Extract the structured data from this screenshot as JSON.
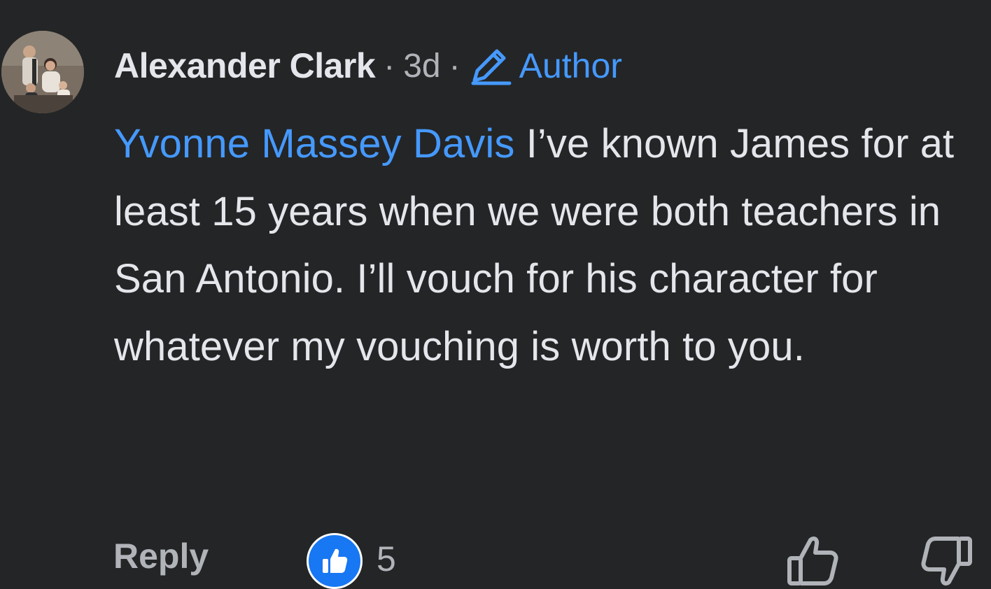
{
  "comment": {
    "author": "Alexander Clark",
    "separator": "·",
    "time": "3d",
    "badge": "Author",
    "mention": "Yvonne Massey Davis",
    "text": " I’ve known James for at least 15 years when we were both teachers in San Antonio. I’ll vouch for his character for whatever my vouching is worth to you."
  },
  "actions": {
    "reply_label": "Reply",
    "like_count": "5"
  },
  "icons": {
    "badge_icon": "pencil-icon",
    "reaction_icon": "thumbs-up-reaction-icon",
    "upvote_icon": "thumbs-up-outline-icon",
    "downvote_icon": "thumbs-down-outline-icon"
  },
  "colors": {
    "background": "#242526",
    "primary_text": "#e4e6eb",
    "secondary_text": "#b0b3b8",
    "accent": "#4599ff",
    "like_blue": "#1877f2"
  }
}
